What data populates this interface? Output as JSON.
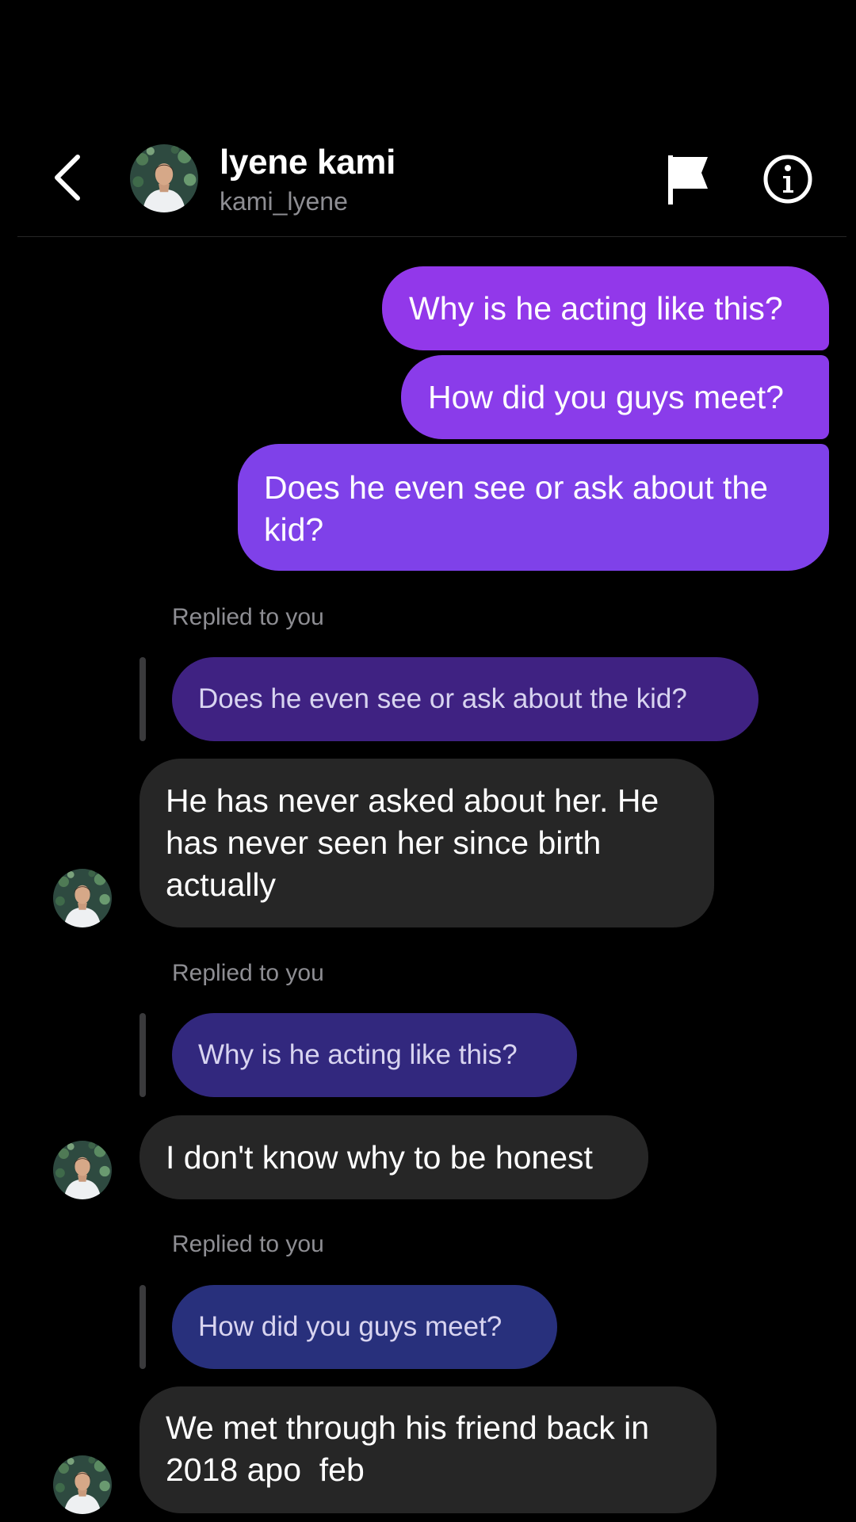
{
  "header": {
    "name": "lyene kami",
    "handle": "kami_lyene",
    "back_icon": "chevron-left-icon",
    "flag_icon": "flag-icon",
    "info_icon": "info-icon"
  },
  "outgoing": [
    "Why is he acting like this?",
    "How did you guys meet?",
    "Does he even see or ask about the kid?"
  ],
  "replies": [
    {
      "label": "Replied to you",
      "quoted": "Does he even see or ask about the kid?",
      "lines": [
        "He has never asked about her. He",
        "has never seen her since birth",
        "actually"
      ]
    },
    {
      "label": "Replied to you",
      "quoted": "Why is he acting like this?",
      "lines": [
        "I don't know why to be honest"
      ]
    },
    {
      "label": "Replied to you",
      "quoted": "How did you guys meet?",
      "lines": [
        "We met through his friend back in",
        "2018 apo  feb"
      ]
    }
  ],
  "colors": {
    "background": "#000000",
    "outgoing_top": "#9238ea",
    "outgoing_bottom": "#7f41e9",
    "incoming": "#262626",
    "quote_1": "#3f2282",
    "quote_2": "#32287e",
    "quote_3": "#28307c",
    "muted_text": "#8e8e93"
  }
}
